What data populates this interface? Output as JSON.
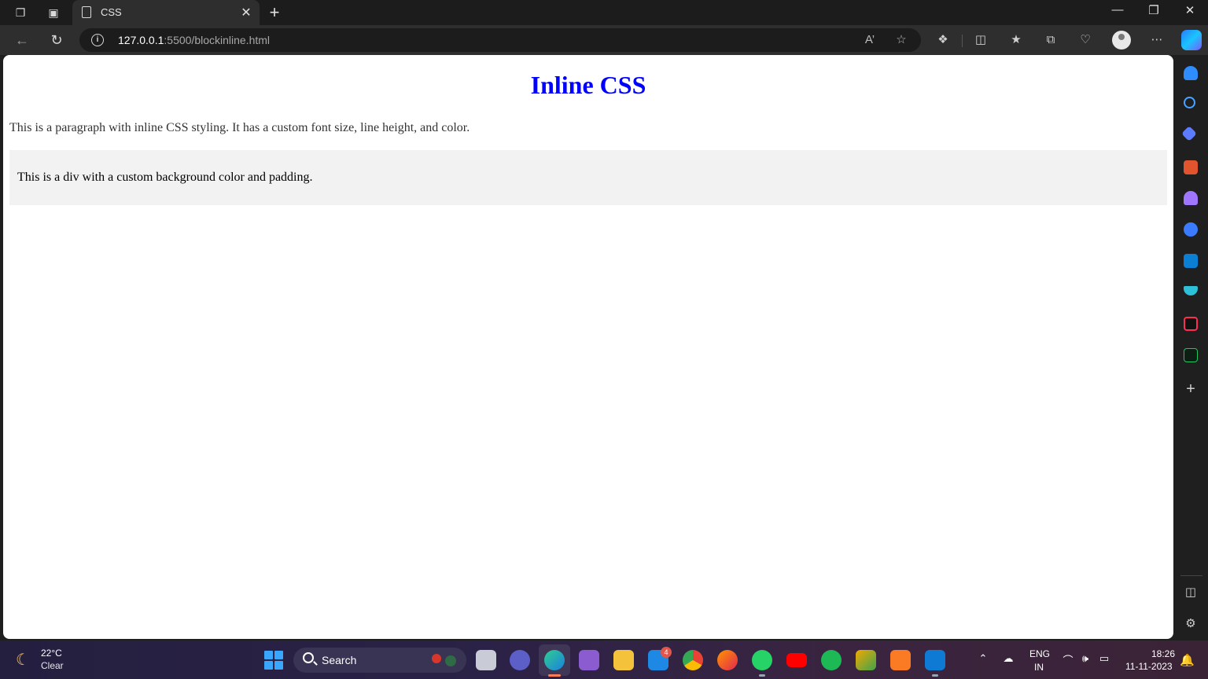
{
  "browser": {
    "tab": {
      "title": "CSS"
    },
    "url": {
      "host": "127.0.0.1",
      "rest": ":5500/blockinline.html"
    }
  },
  "page": {
    "heading": "Inline CSS",
    "paragraph": "This is a paragraph with inline CSS styling. It has a custom font size, line height, and color.",
    "div_text": "This is a div with a custom background color and padding.",
    "colors": {
      "heading": "#0000ff",
      "paragraph": "#333333",
      "div_background": "#f2f2f2"
    }
  },
  "taskbar": {
    "weather": {
      "temp": "22°C",
      "condition": "Clear"
    },
    "search_label": "Search",
    "mail_badge": "4",
    "language": {
      "line1": "ENG",
      "line2": "IN"
    },
    "clock": {
      "time": "18:26",
      "date": "11-11-2023"
    }
  }
}
